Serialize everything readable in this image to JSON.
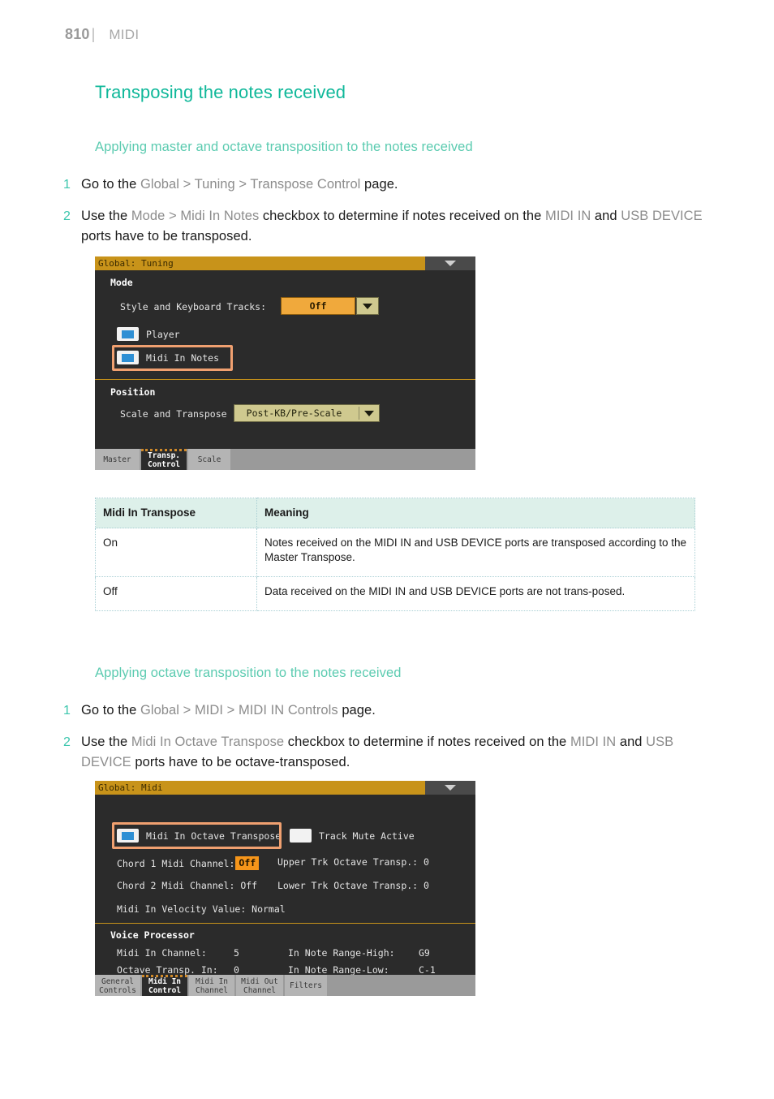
{
  "header": {
    "page_number": "810",
    "divider": "|",
    "chapter": "MIDI"
  },
  "headings": {
    "h1": "Transposing the notes received",
    "section_a": "Applying master and octave transposition to the notes received",
    "section_b": "Applying octave transposition to the notes received"
  },
  "steps_a": [
    {
      "num": "1",
      "pre": "Go to the ",
      "ui1": "Global",
      "sep1": " > ",
      "ui2": "Tuning",
      "sep2": " > ",
      "ui3": "Transpose Control",
      "post": " page."
    },
    {
      "num": "2",
      "pre": "Use the ",
      "ui1": "Mode",
      "sep1": " > ",
      "ui2": "Midi In Notes",
      "mid": " checkbox to determine if notes received on the ",
      "ui3": "MIDI IN",
      "mid2": " and ",
      "ui4": "USB DEVICE",
      "post": " ports have to be transposed."
    }
  ],
  "steps_b": [
    {
      "num": "1",
      "pre": "Go to the ",
      "ui1": "Global",
      "sep1": " > ",
      "ui2": "MIDI",
      "sep2": " > ",
      "ui3": "MIDI IN Controls",
      "post": " page."
    },
    {
      "num": "2",
      "pre": "Use the ",
      "ui1": "Midi In Octave Transpose",
      "mid": " checkbox to determine if notes received on the ",
      "ui3": "MIDI IN",
      "mid2": " and ",
      "ui4": "USB DEVICE",
      "post": " ports have to be octave-transposed."
    }
  ],
  "panel_tuning": {
    "title": "Global: Tuning",
    "mode_section_label": "Mode",
    "style_tracks_label": "Style and Keyboard Tracks:",
    "style_tracks_value": "Off",
    "player_label": "Player",
    "player_checked": true,
    "midi_in_notes_label": "Midi In Notes",
    "midi_in_notes_checked": true,
    "position_section_label": "Position",
    "scale_transpose_label": "Scale and Transpose :",
    "scale_transpose_value": "Post-KB/Pre-Scale",
    "tabs": [
      {
        "line1": "Master",
        "line2": "",
        "active": false
      },
      {
        "line1": "Transp.",
        "line2": "Control",
        "active": true
      },
      {
        "line1": "Scale",
        "line2": "",
        "active": false
      }
    ]
  },
  "panel_midi": {
    "title": "Global: Midi",
    "octave_transpose_label": "Midi In Octave Transpose",
    "octave_transpose_checked": true,
    "track_mute_label": "Track Mute Active",
    "track_mute_checked": false,
    "chord1_label": "Chord 1 Midi Channel:",
    "chord1_value": "Off",
    "chord2_label": "Chord 2 Midi Channel: Off",
    "velocity_label": "Midi In Velocity Value: Normal",
    "upper_trk_label": "Upper Trk Octave Transp.: 0",
    "lower_trk_label": "Lower Trk Octave Transp.: 0",
    "voice_processor_label": "Voice Processor",
    "vp_midi_in_channel_label": "Midi In Channel:",
    "vp_midi_in_channel_value": "5",
    "vp_octave_transp_label": "Octave Transp. In:",
    "vp_octave_transp_value": "0",
    "vp_range_high_label": "In Note Range-High:",
    "vp_range_high_value": "G9",
    "vp_range_low_label": "In Note Range-Low:",
    "vp_range_low_value": "C-1",
    "tabs": [
      {
        "line1": "General",
        "line2": "Controls",
        "active": false
      },
      {
        "line1": "Midi In",
        "line2": "Control",
        "active": true
      },
      {
        "line1": "Midi In",
        "line2": "Channel",
        "active": false
      },
      {
        "line1": "Midi Out",
        "line2": "Channel",
        "active": false
      },
      {
        "line1": "Filters",
        "line2": "",
        "active": false
      }
    ]
  },
  "table": {
    "headers": [
      "Midi In Transpose",
      "Meaning"
    ],
    "rows": [
      [
        "On",
        "Notes received on the MIDI IN and USB DEVICE ports are transposed according to the Master Transpose."
      ],
      [
        "Off",
        "Data received on the MIDI IN and USB DEVICE ports are not trans-posed."
      ]
    ]
  },
  "colors": {
    "accent_teal": "#10b89a",
    "accent_teal_light": "#5bcbb0",
    "device_titlebar": "#c8931a",
    "device_bg": "#2b2b2b",
    "checkbox_fill": "#2e8fd4",
    "highlight_ring": "#f0a070",
    "value_orange": "#f0a93c",
    "value_khaki": "#cfc98f",
    "table_header_bg": "#ddf0ea"
  }
}
